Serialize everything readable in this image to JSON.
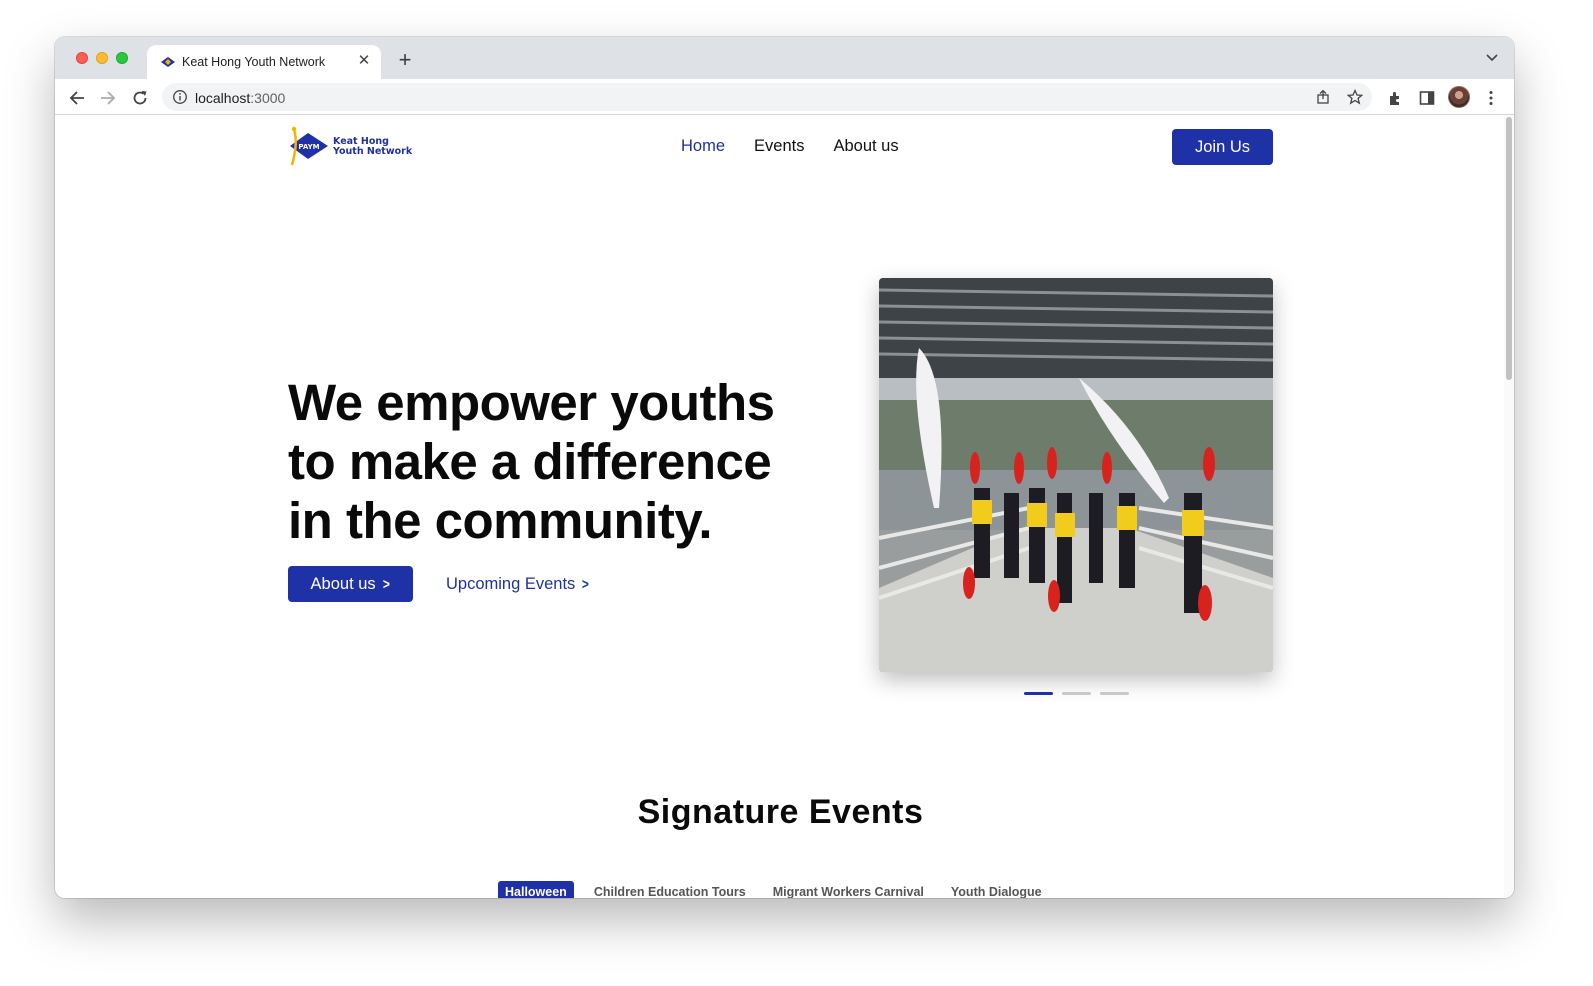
{
  "browser": {
    "tab_title": "Keat Hong Youth Network",
    "url_host": "localhost",
    "url_port": ":3000"
  },
  "site": {
    "logo_text_line1": "Keat Hong",
    "logo_text_line2": "Youth Network",
    "logo_badge": "PAYM",
    "nav": [
      {
        "label": "Home",
        "active": true
      },
      {
        "label": "Events",
        "active": false
      },
      {
        "label": "About us",
        "active": false
      }
    ],
    "join_label": "Join Us"
  },
  "hero": {
    "line1": "We empower youths",
    "line2_prefix": "to ",
    "line2_bold": "make a difference",
    "line3": "in the community.",
    "primary_button": "About us",
    "secondary_link": "Upcoming Events",
    "slides_total": 3,
    "active_slide": 1
  },
  "signature": {
    "title": "Signature Events",
    "tabs": [
      {
        "label": "Halloween",
        "active": true
      },
      {
        "label": "Children Education Tours",
        "active": false
      },
      {
        "label": "Migrant Workers Carnival",
        "active": false
      },
      {
        "label": "Youth Dialogue",
        "active": false
      }
    ]
  },
  "colors": {
    "brand": "#1e31a6",
    "text": "#0a0a0a"
  }
}
